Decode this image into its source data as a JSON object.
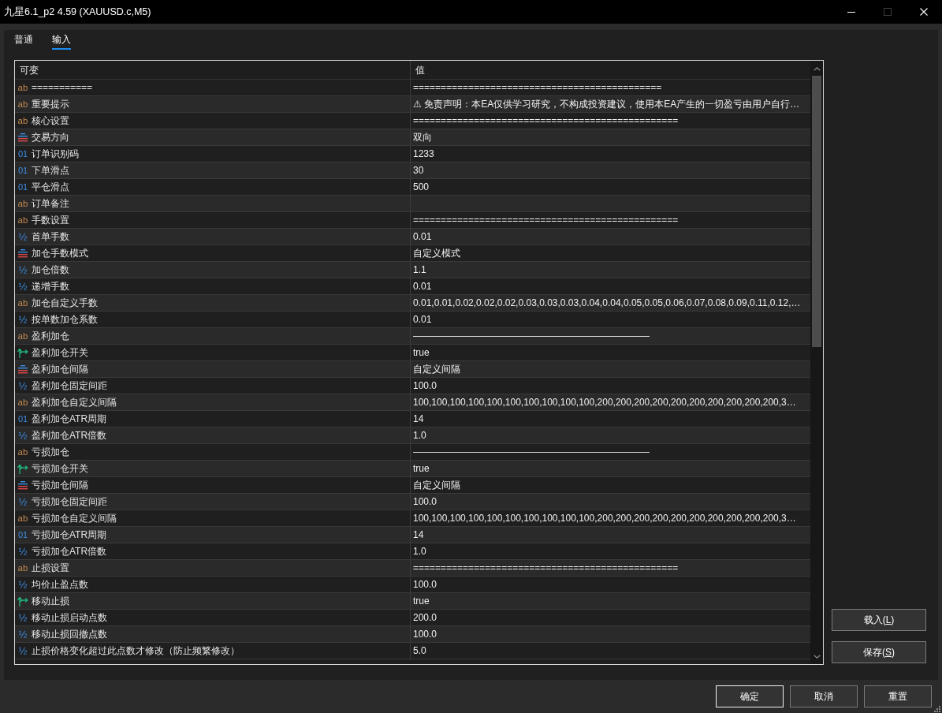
{
  "window": {
    "title": "九星6.1_p2 4.59 (XAUUSD.c,M5)",
    "buttons": [
      {
        "kind": "minimize",
        "disabled": false
      },
      {
        "kind": "maximize",
        "disabled": true
      },
      {
        "kind": "close",
        "disabled": false
      }
    ]
  },
  "tabs": [
    {
      "label": "普通",
      "selected": false
    },
    {
      "label": "输入",
      "selected": true
    }
  ],
  "table": {
    "columns": [
      "可变",
      "值"
    ],
    "rows": [
      {
        "kind": "string",
        "icon": "ab",
        "name": "===========",
        "value": "============================================="
      },
      {
        "kind": "string",
        "icon": "ab",
        "name": "重要提示",
        "value": "⚠ 免责声明：本EA仅供学习研究，不构成投资建议，使用本EA产生的一切盈亏由用户自行…"
      },
      {
        "kind": "string",
        "icon": "ab",
        "name": "核心设置",
        "value": "================================================"
      },
      {
        "kind": "enum",
        "name": "交易方向",
        "value": "双向"
      },
      {
        "kind": "int",
        "icon": "01",
        "name": "订单识别码",
        "value": "1233"
      },
      {
        "kind": "int",
        "icon": "01",
        "name": "下单滑点",
        "value": "30"
      },
      {
        "kind": "int",
        "icon": "01",
        "name": "平仓滑点",
        "value": "500"
      },
      {
        "kind": "string",
        "icon": "ab",
        "name": "订单备注"
      },
      {
        "kind": "string",
        "icon": "ab",
        "name": "手数设置",
        "value": "================================================"
      },
      {
        "kind": "double",
        "icon": "½",
        "name": "首单手数",
        "value": "0.01"
      },
      {
        "kind": "enum",
        "name": "加仓手数模式",
        "value": "自定义模式"
      },
      {
        "kind": "double",
        "icon": "½",
        "name": "加仓倍数",
        "value": "1.1"
      },
      {
        "kind": "double",
        "icon": "½",
        "name": "递增手数",
        "value": "0.01"
      },
      {
        "kind": "string",
        "icon": "ab",
        "name": "加仓自定义手数",
        "value": "0.01,0.01,0.02,0.02,0.02,0.03,0.03,0.03,0.04,0.04,0.05,0.05,0.06,0.07,0.08,0.09,0.11,0.12,…"
      },
      {
        "kind": "double",
        "icon": "½",
        "name": "按单数加仓系数",
        "value": "0.01"
      },
      {
        "kind": "string",
        "icon": "ab",
        "name": "盈利加仓",
        "value": "—————————————————————————"
      },
      {
        "kind": "bool",
        "name": "盈利加仓开关",
        "value": "true"
      },
      {
        "kind": "enum",
        "name": "盈利加仓间隔",
        "value": "自定义间隔"
      },
      {
        "kind": "double",
        "icon": "½",
        "name": "盈利加仓固定间距",
        "value": "100.0"
      },
      {
        "kind": "string",
        "icon": "ab",
        "name": "盈利加仓自定义间隔",
        "value": "100,100,100,100,100,100,100,100,100,100,200,200,200,200,200,200,200,200,200,200,3…"
      },
      {
        "kind": "int",
        "icon": "01",
        "name": "盈利加仓ATR周期",
        "value": "14"
      },
      {
        "kind": "double",
        "icon": "½",
        "name": "盈利加仓ATR倍数",
        "value": "1.0"
      },
      {
        "kind": "string",
        "icon": "ab",
        "name": "亏损加仓",
        "value": "—————————————————————————"
      },
      {
        "kind": "bool",
        "name": "亏损加仓开关",
        "value": "true"
      },
      {
        "kind": "enum",
        "name": "亏损加仓间隔",
        "value": "自定义间隔"
      },
      {
        "kind": "double",
        "icon": "½",
        "name": "亏损加仓固定间距",
        "value": "100.0"
      },
      {
        "kind": "string",
        "icon": "ab",
        "name": "亏损加仓自定义间隔",
        "value": "100,100,100,100,100,100,100,100,100,100,200,200,200,200,200,200,200,200,200,200,3…"
      },
      {
        "kind": "int",
        "icon": "01",
        "name": "亏损加仓ATR周期",
        "value": "14"
      },
      {
        "kind": "double",
        "icon": "½",
        "name": "亏损加仓ATR倍数",
        "value": "1.0"
      },
      {
        "kind": "string",
        "icon": "ab",
        "name": "止损设置",
        "value": "================================================"
      },
      {
        "kind": "double",
        "icon": "½",
        "name": "均价止盈点数",
        "value": "100.0"
      },
      {
        "kind": "bool",
        "name": "移动止损",
        "value": "true"
      },
      {
        "kind": "double",
        "icon": "½",
        "name": "移动止损启动点数",
        "value": "200.0"
      },
      {
        "kind": "double",
        "icon": "½",
        "name": "移动止损回撤点数",
        "value": "100.0"
      },
      {
        "kind": "double",
        "icon": "½",
        "name": "止损价格变化超过此点数才修改（防止频繁修改）",
        "value": "5.0"
      }
    ]
  },
  "side_buttons": [
    {
      "label": "载入(",
      "hotkey": "L",
      "label_end": ")"
    },
    {
      "label": "保存(",
      "hotkey": "S",
      "label_end": ")"
    }
  ],
  "footer_buttons": [
    {
      "label": "确定",
      "default": true
    },
    {
      "label": "取消",
      "default": false
    },
    {
      "label": "重置",
      "default": false
    }
  ]
}
